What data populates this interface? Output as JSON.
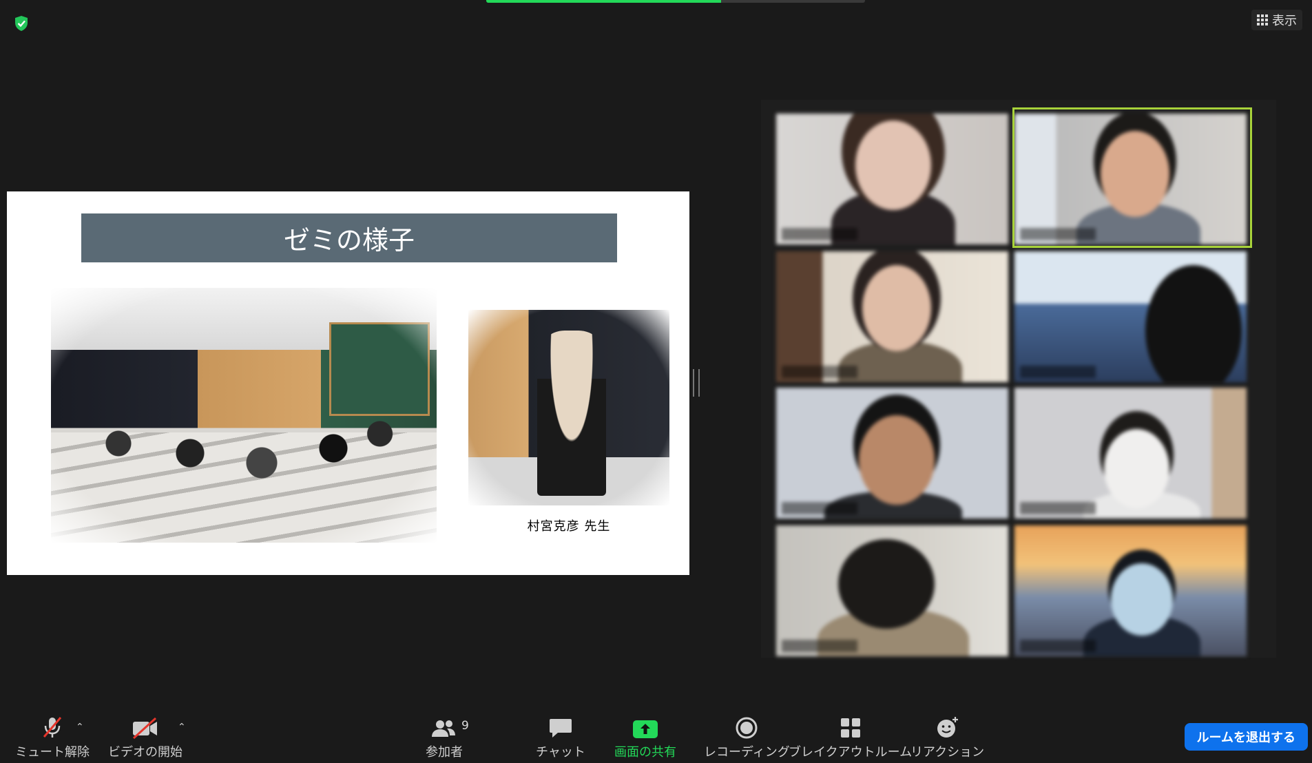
{
  "top": {
    "view_label": "表示",
    "share_progress": 0.62
  },
  "slide": {
    "title": "ゼミの様子",
    "teacher_caption": "村宮克彦 先生"
  },
  "toolbar": {
    "unmute": "ミュート解除",
    "start_video": "ビデオの開始",
    "participants": "参加者",
    "participants_count": "9",
    "chat": "チャット",
    "share_screen": "画面の共有",
    "recording": "レコーディング",
    "breakout": "ブレイクアウトルーム",
    "reactions": "リアクション",
    "leave_room": "ルームを退出する"
  },
  "colors": {
    "accent_green": "#23d959",
    "leave_blue": "#0e72ed",
    "active_speaker": "#a8d33a",
    "slide_title_bg": "#5a6a75"
  }
}
